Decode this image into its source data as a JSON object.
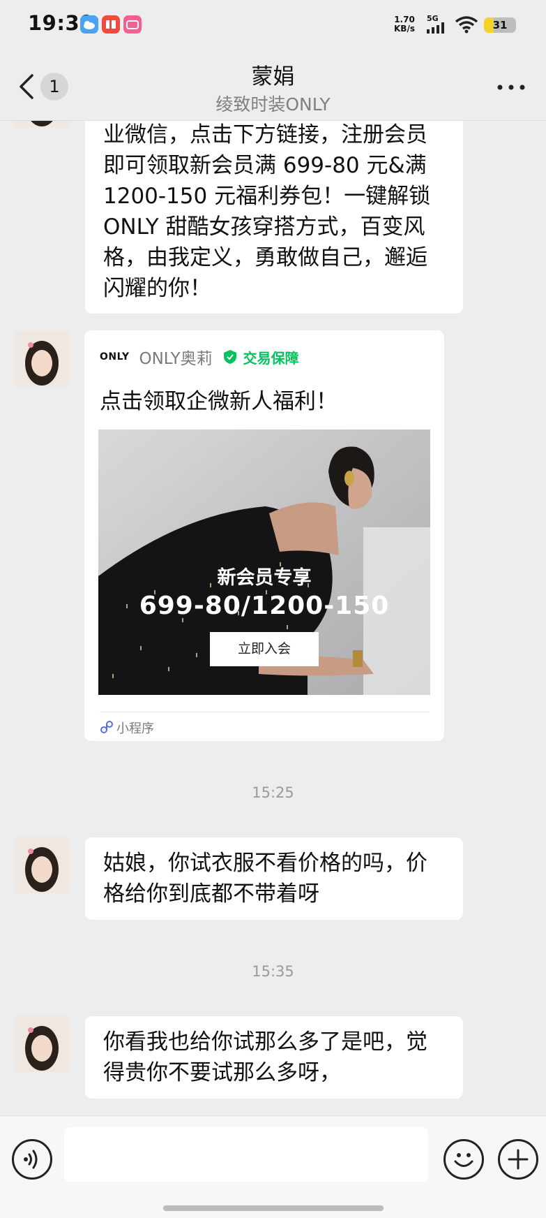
{
  "status_bar": {
    "time": "19:39",
    "net_speed_value": "1.70",
    "net_speed_unit": "KB/s",
    "network": "5G",
    "battery": "31",
    "battery_level": 0.31
  },
  "header": {
    "title": "蒙娟",
    "subtitle": "绫致时装ONLY",
    "unread_count": "1"
  },
  "messages": {
    "m1_lines": [
      "业微信，点击下方链接，注册会员",
      "即可领取新会员满 699-80 元&满",
      "1200-150 元福利券包！一键解锁",
      "ONLY 甜酷女孩穿搭方式，百变风",
      "格，由我定义，勇敢做自己，邂逅",
      "闪耀的你！"
    ],
    "card": {
      "brand_logo": "ONLY",
      "brand_name": "ONLY奥莉",
      "badge": "交易保障",
      "title": "点击领取企微新人福利！",
      "promo_title": "新会员专享",
      "promo_price": "699-80/1200-150",
      "button": "立即入会",
      "footer_label": "小程序"
    },
    "time1": "15:25",
    "m2_lines": [
      "姑娘，你试衣服不看价格的吗，价",
      "格给你到底都不带着呀"
    ],
    "time2": "15:35",
    "m3_lines": [
      "你看我也给你试那么多了是吧，觉",
      "得贵你不要试那么多呀，"
    ]
  },
  "input": {
    "placeholder": ""
  },
  "colors": {
    "badge_green": "#07c160",
    "bubble_bg": "#ffffff",
    "chat_bg": "#ededed"
  }
}
